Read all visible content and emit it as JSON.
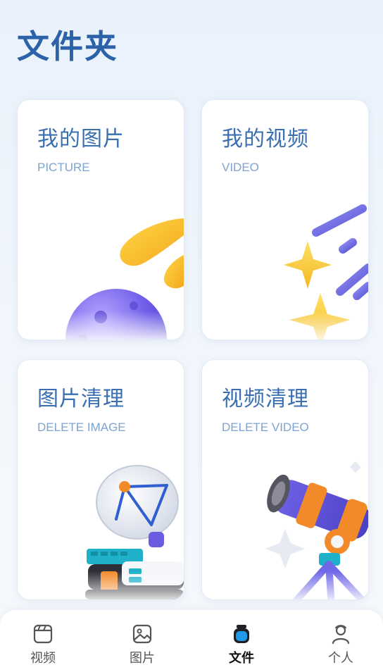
{
  "page": {
    "title": "文件夹"
  },
  "cards": [
    {
      "title": "我的图片",
      "subtitle": "PICTURE"
    },
    {
      "title": "我的视频",
      "subtitle": "VIDEO"
    },
    {
      "title": "图片清理",
      "subtitle": "DELETE IMAGE"
    },
    {
      "title": "视频清理",
      "subtitle": "DELETE VIDEO"
    }
  ],
  "nav": {
    "items": [
      {
        "label": "视频",
        "icon": "clapperboard-icon"
      },
      {
        "label": "图片",
        "icon": "image-icon"
      },
      {
        "label": "文件",
        "icon": "jar-icon",
        "active": true
      },
      {
        "label": "个人",
        "icon": "person-icon"
      }
    ]
  },
  "colors": {
    "accent": "#2c63a8",
    "active_icon": "#1e9be8"
  }
}
